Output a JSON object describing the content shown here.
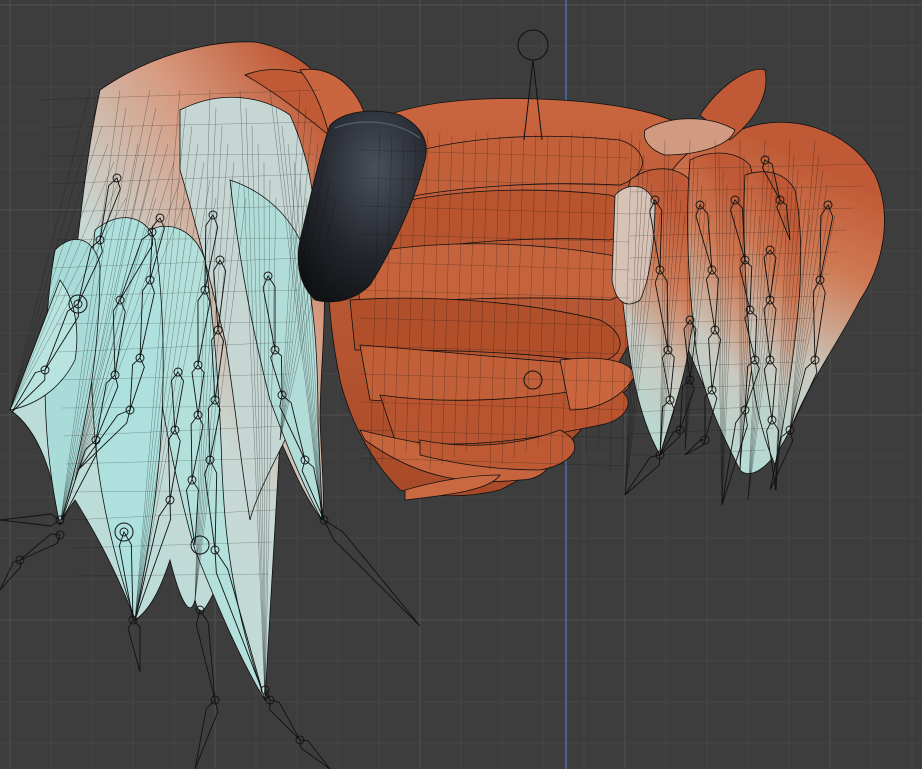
{
  "viewport": {
    "background_color": "#3d3d3d",
    "grid_minor_color": "#454545",
    "grid_major_color": "#515151",
    "axis_color": "#4a73b8"
  },
  "model": {
    "hair_tip_color": "#aee1dd",
    "hair_root_color": "#c05a36",
    "hair_dark_color": "#8e3a1e",
    "band_color": "#1d1f24",
    "wireframe_color": "#101010"
  },
  "gizmos": {
    "empty_marker_icon": "circle-empty-icon",
    "bone_icon": "bone-octahedral-icon"
  }
}
